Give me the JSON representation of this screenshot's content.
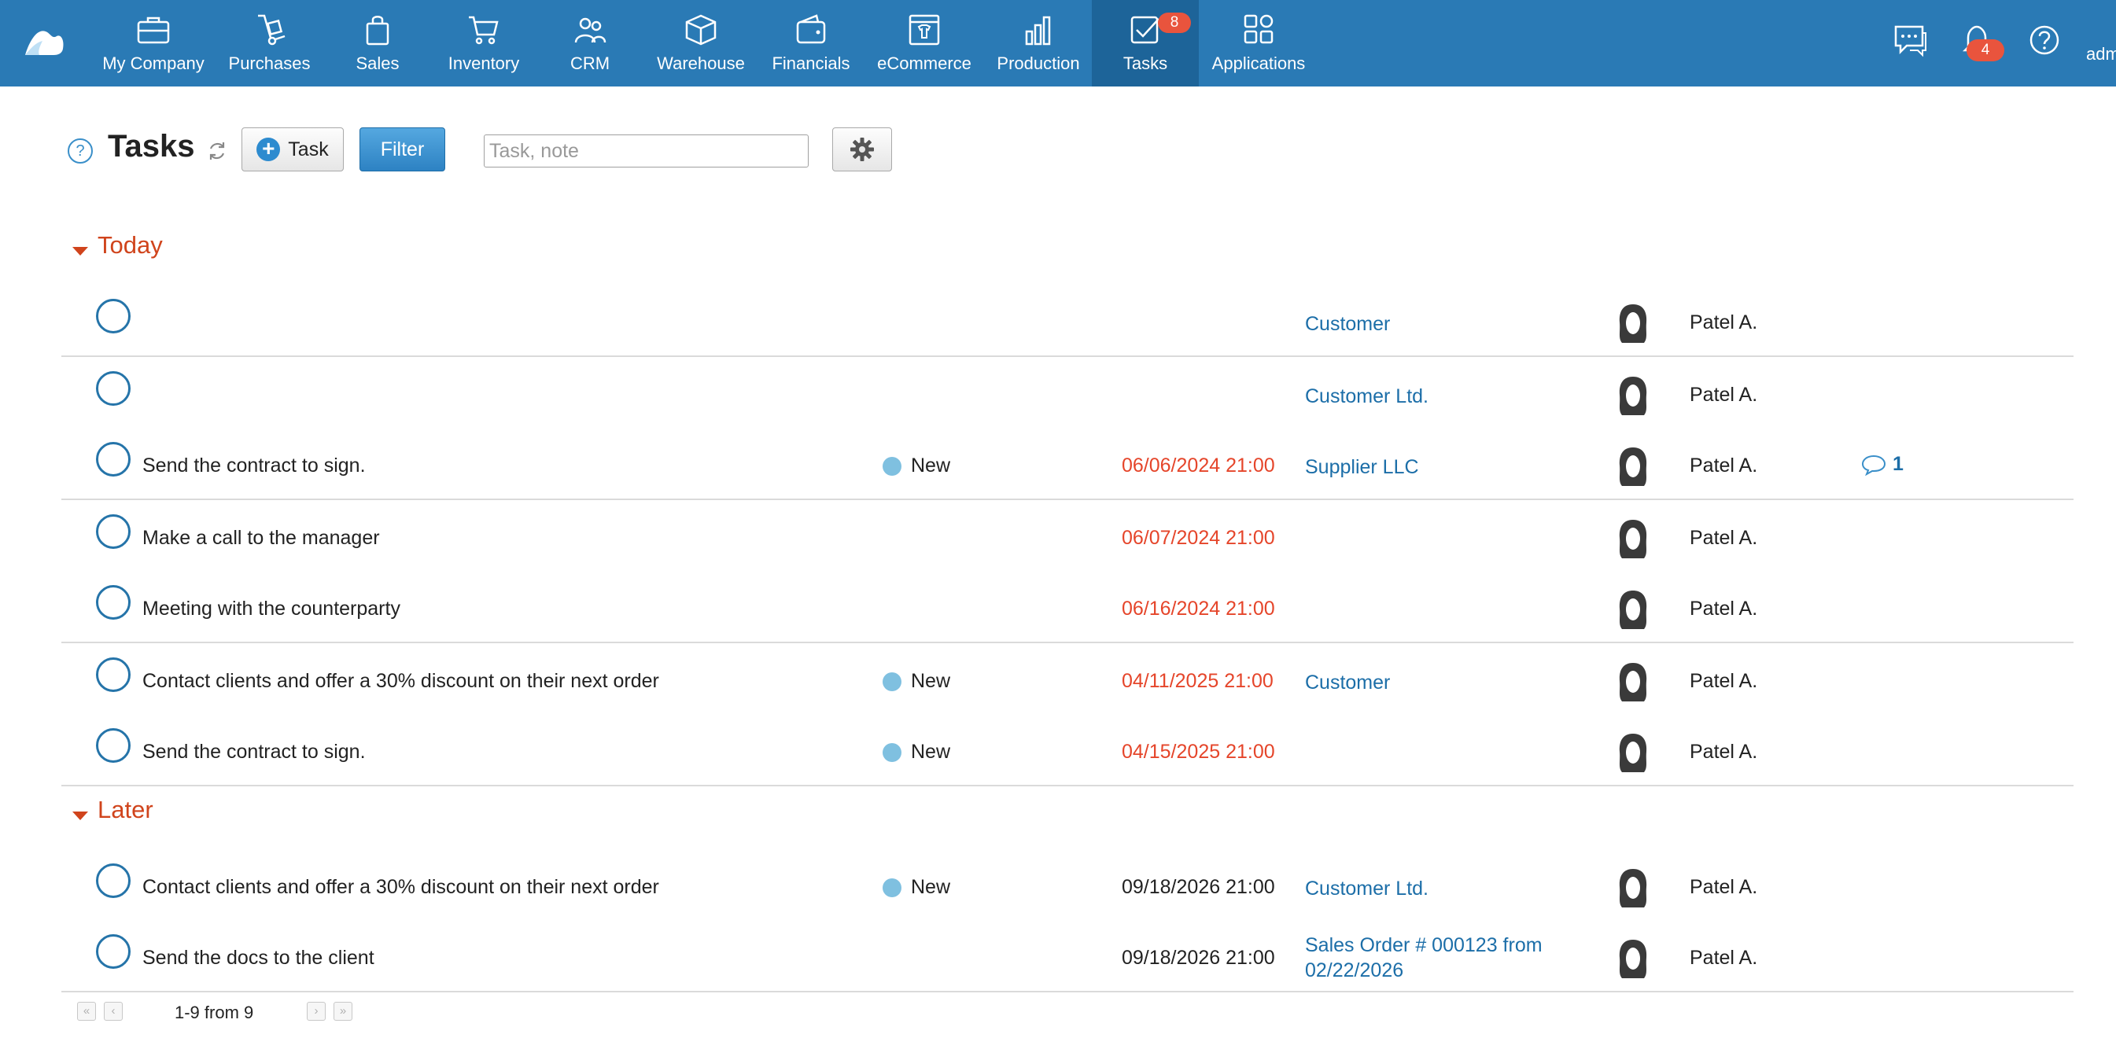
{
  "nav": {
    "items": [
      {
        "label": "My Company",
        "icon": "briefcase-icon"
      },
      {
        "label": "Purchases",
        "icon": "hand-truck-icon"
      },
      {
        "label": "Sales",
        "icon": "shopping-bag-icon"
      },
      {
        "label": "Inventory",
        "icon": "cart-icon"
      },
      {
        "label": "CRM",
        "icon": "people-icon"
      },
      {
        "label": "Warehouse",
        "icon": "box-icon"
      },
      {
        "label": "Financials",
        "icon": "wallet-icon"
      },
      {
        "label": "eCommerce",
        "icon": "storefront-icon"
      },
      {
        "label": "Production",
        "icon": "bar-chart-icon"
      },
      {
        "label": "Tasks",
        "icon": "checkbox-icon",
        "badge": "8",
        "active": true
      },
      {
        "label": "Applications",
        "icon": "apps-grid-icon"
      }
    ],
    "notifications_badge": "4",
    "user_label": "adm"
  },
  "toolbar": {
    "help": "?",
    "title": "Tasks",
    "task_button": "Task",
    "filter_button": "Filter",
    "search_placeholder": "Task, note"
  },
  "groups": [
    {
      "label": "Today",
      "rows": [
        {
          "text": "",
          "status": "",
          "due": "",
          "due_overdue": false,
          "link": "Customer",
          "assignee": "Patel A.",
          "comments": ""
        },
        {
          "text": "",
          "status": "",
          "due": "",
          "due_overdue": false,
          "link": "Customer Ltd.",
          "assignee": "Patel A.",
          "comments": ""
        },
        {
          "text": "Send the contract to sign.",
          "status": "New",
          "due": "06/06/2024 21:00",
          "due_overdue": true,
          "link": "Supplier LLC",
          "assignee": "Patel A.",
          "comments": "1"
        },
        {
          "text": "Make a call to the manager",
          "status": "",
          "due": "06/07/2024 21:00",
          "due_overdue": true,
          "link": "",
          "assignee": "Patel A.",
          "comments": ""
        },
        {
          "text": "Meeting with the counterparty",
          "status": "",
          "due": "06/16/2024 21:00",
          "due_overdue": true,
          "link": "",
          "assignee": "Patel A.",
          "comments": ""
        },
        {
          "text": "Contact clients and offer a 30% discount on their next order",
          "status": "New",
          "due": "04/11/2025 21:00",
          "due_overdue": true,
          "link": "Customer",
          "assignee": "Patel A.",
          "comments": ""
        },
        {
          "text": "Send the contract to sign.",
          "status": "New",
          "due": "04/15/2025 21:00",
          "due_overdue": true,
          "link": "",
          "assignee": "Patel A.",
          "comments": ""
        }
      ]
    },
    {
      "label": "Later",
      "rows": [
        {
          "text": "Contact clients and offer a 30% discount on their next order",
          "status": "New",
          "due": "09/18/2026 21:00",
          "due_overdue": false,
          "link": "Customer Ltd.",
          "assignee": "Patel A.",
          "comments": ""
        },
        {
          "text": "Send the docs to the client",
          "status": "",
          "due": "09/18/2026 21:00",
          "due_overdue": false,
          "link": "Sales Order # 000123 from 02/22/2026",
          "link_line1": "Sales Order # 000123 from",
          "link_line2": "02/22/2026",
          "assignee": "Patel A.",
          "comments": ""
        }
      ]
    }
  ],
  "pagination": {
    "first": "«",
    "prev": "‹",
    "range": "1-9 from 9",
    "next": "›",
    "last": "»"
  },
  "colors": {
    "topbar": "#2a7ab5",
    "active_nav": "#1d6499",
    "group_header": "#d0441c",
    "overdue": "#e5452a",
    "link": "#1c6ea8",
    "status_new": "#7fc0e0",
    "badge": "#e9543d"
  }
}
